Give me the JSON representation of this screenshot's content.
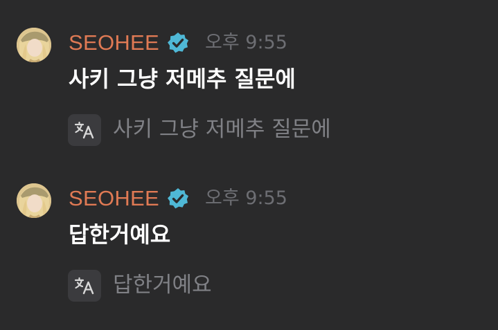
{
  "colors": {
    "background": "#2a2a2b",
    "username": "#e07a54",
    "verified_badge": "#4fb8d6",
    "timestamp": "#6d6e73",
    "message_text": "#ffffff",
    "translated_text": "#808186",
    "translate_button_bg": "#3b3b3e"
  },
  "messages": [
    {
      "username": "SEOHEE",
      "avatar_icon": "avatar-image",
      "verified_icon": "verified-badge-icon",
      "timestamp": "오후 9:55",
      "text": "사키 그냥 저메추 질문에",
      "translate_icon": "translate-icon",
      "translated_text": "사키 그냥 저메추 질문에"
    },
    {
      "username": "SEOHEE",
      "avatar_icon": "avatar-image",
      "verified_icon": "verified-badge-icon",
      "timestamp": "오후 9:55",
      "text": "답한거예요",
      "translate_icon": "translate-icon",
      "translated_text": "답한거예요"
    }
  ]
}
